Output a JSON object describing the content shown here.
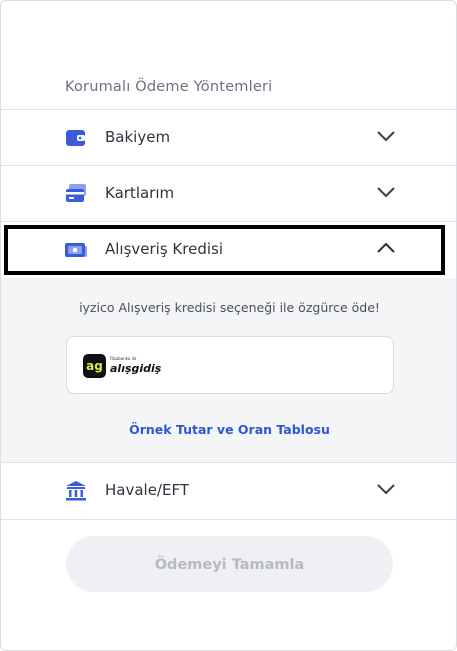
{
  "header": {
    "title": "Korumalı Ödeme Yöntemleri"
  },
  "methods": [
    {
      "label": "Bakiyem",
      "icon": "wallet-icon",
      "expanded": false
    },
    {
      "label": "Kartlarım",
      "icon": "cards-icon",
      "expanded": false
    },
    {
      "label": "Alışveriş Kredisi",
      "icon": "cash-icon",
      "expanded": true
    },
    {
      "label": "Havale/EFT",
      "icon": "bank-icon",
      "expanded": false
    }
  ],
  "credit_panel": {
    "description": "iyzico Alışveriş kredisi seçeneği ile özgürce öde!",
    "brand": {
      "tagline": "Fibabanka ile",
      "name": "alışgidiş",
      "badge": "ag"
    },
    "table_link": "Örnek Tutar ve Oran Tablosu"
  },
  "complete_button": {
    "label": "Ödemeyi Tamamla"
  },
  "colors": {
    "accent": "#2f56d3",
    "icon_blue": "#3b5bdb",
    "panel_bg": "#f4f5f7",
    "disabled_bg": "#eef0f3"
  }
}
